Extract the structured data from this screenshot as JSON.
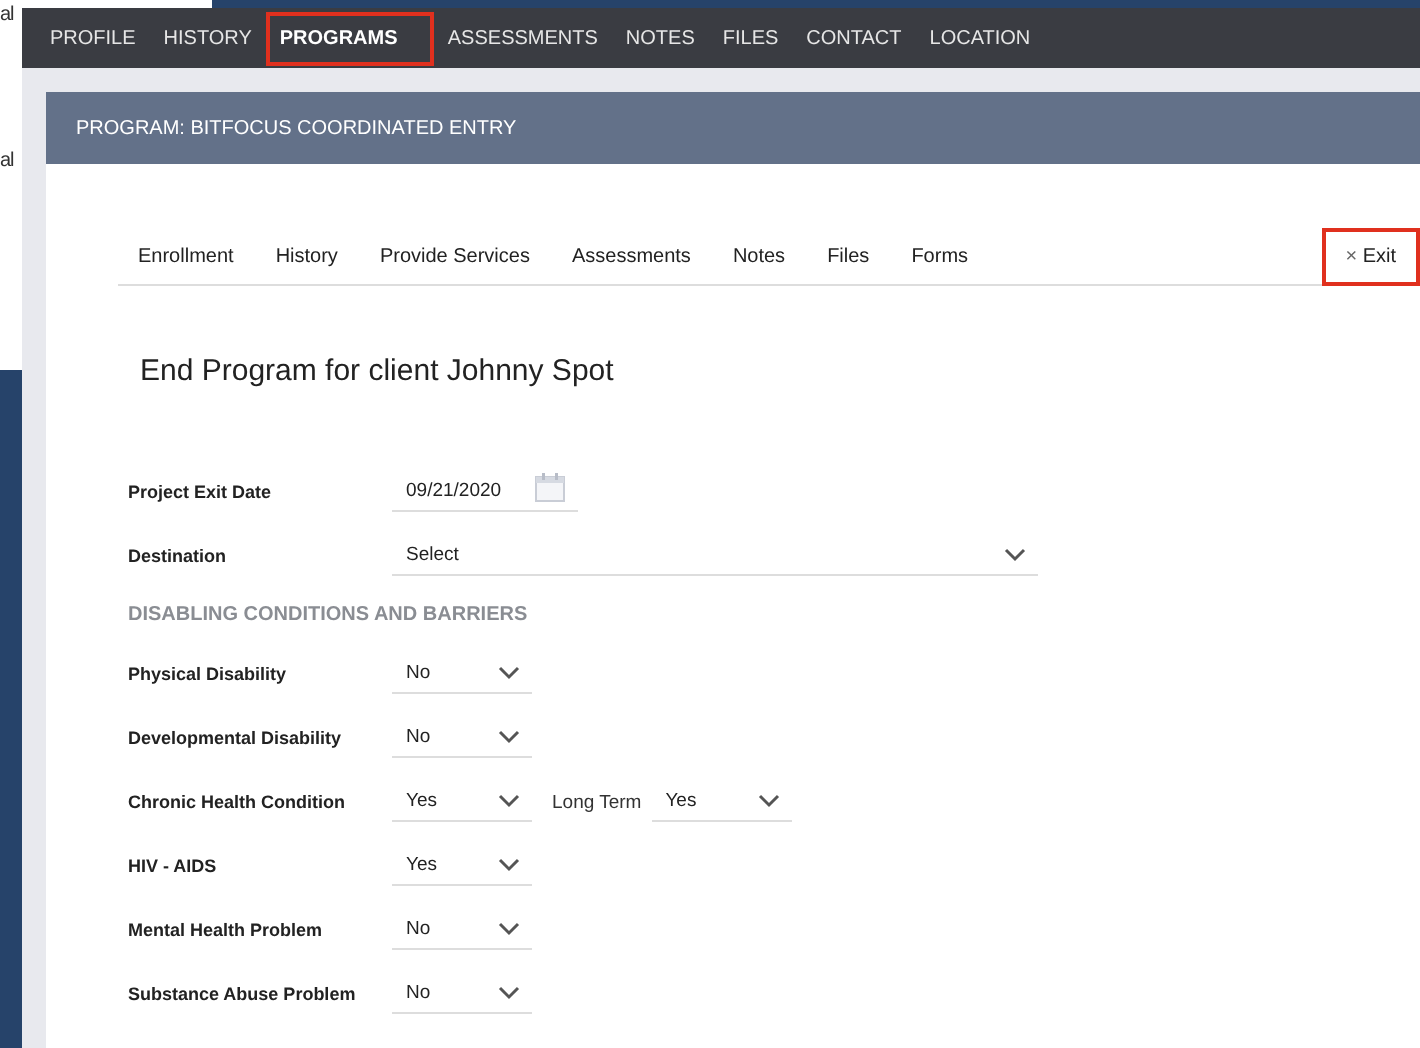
{
  "left_fragments": [
    "al",
    "al"
  ],
  "nav": [
    {
      "label": "PROFILE",
      "selected": false,
      "highlighted": false
    },
    {
      "label": "HISTORY",
      "selected": false,
      "highlighted": false
    },
    {
      "label": "PROGRAMS",
      "selected": true,
      "highlighted": true
    },
    {
      "label": "ASSESSMENTS",
      "selected": false,
      "highlighted": false
    },
    {
      "label": "NOTES",
      "selected": false,
      "highlighted": false
    },
    {
      "label": "FILES",
      "selected": false,
      "highlighted": false
    },
    {
      "label": "CONTACT",
      "selected": false,
      "highlighted": false
    },
    {
      "label": "LOCATION",
      "selected": false,
      "highlighted": false
    }
  ],
  "panel_title": "PROGRAM: BITFOCUS COORDINATED ENTRY",
  "tabs": [
    {
      "label": "Enrollment"
    },
    {
      "label": "History"
    },
    {
      "label": "Provide Services"
    },
    {
      "label": "Assessments"
    },
    {
      "label": "Notes"
    },
    {
      "label": "Files"
    },
    {
      "label": "Forms"
    }
  ],
  "exit_button": {
    "icon": "×",
    "label": "Exit",
    "highlighted": true
  },
  "heading": "End Program for client Johnny Spot",
  "exit_date": {
    "label": "Project Exit Date",
    "value": "09/21/2020"
  },
  "destination": {
    "label": "Destination",
    "value": "Select"
  },
  "section_title": "DISABLING CONDITIONS AND BARRIERS",
  "conditions": [
    {
      "label": "Physical Disability",
      "value": "No"
    },
    {
      "label": "Developmental Disability",
      "value": "No"
    },
    {
      "label": "Chronic Health Condition",
      "value": "Yes",
      "extra": {
        "label": "Long Term",
        "value": "Yes"
      }
    },
    {
      "label": "HIV - AIDS",
      "value": "Yes"
    },
    {
      "label": "Mental Health Problem",
      "value": "No"
    },
    {
      "label": "Substance Abuse Problem",
      "value": "No"
    }
  ]
}
